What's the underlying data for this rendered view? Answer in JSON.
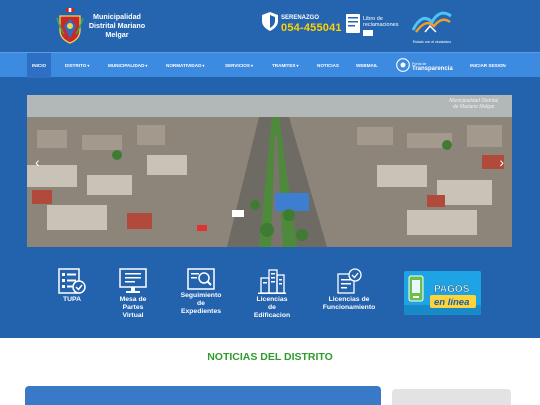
{
  "header": {
    "muni_name": "Municipalidad Distrital Mariano Melgar",
    "serenazgo_label": "SERENAZGO",
    "serenazgo_phone": "054-455041",
    "libro_line1": "Libro de",
    "libro_line2": "reclamaciones",
    "peru_text": "Estado con el ciudadano"
  },
  "nav": {
    "items": [
      {
        "label": "INICIO",
        "caret": ""
      },
      {
        "label": "DISTRITO",
        "caret": "▾"
      },
      {
        "label": "MUNICIPALIDAD",
        "caret": "▾"
      },
      {
        "label": "NORMATIVIDAD",
        "caret": "▾"
      },
      {
        "label": "SERVICIOS",
        "caret": "▾"
      },
      {
        "label": "TRAMITES",
        "caret": "▾"
      },
      {
        "label": "NOTICIAS",
        "caret": ""
      },
      {
        "label": "WEBMAIL",
        "caret": ""
      }
    ],
    "transparencia_small": "Portal de",
    "transparencia_big": "Transparencia",
    "login": "INICIAR SESION"
  },
  "slider": {
    "caption_line1": "Municipalidad Distrital",
    "caption_line2": "de Mariano Melgar",
    "prev": "‹",
    "next": "›"
  },
  "services": [
    {
      "l1": "TUPA",
      "l2": "",
      "l3": "",
      "l4": "",
      "icon": "tupa-icon"
    },
    {
      "l1": "Mesa de",
      "l2": "Partes",
      "l3": "Virtual",
      "l4": "",
      "icon": "monitor-icon"
    },
    {
      "l1": "Seguimiento",
      "l2": "de",
      "l3": "Expedientes",
      "l4": "",
      "icon": "search-document-icon"
    },
    {
      "l1": "Licencias",
      "l2": "de",
      "l3": "Edificacion",
      "l4": "",
      "icon": "buildings-icon"
    },
    {
      "l1": "Licencias de",
      "l2": "Funcionamiento",
      "l3": "",
      "l4": "",
      "icon": "license-icon"
    }
  ],
  "pagos": {
    "line1": "PAGOS",
    "line2": "en línea"
  },
  "news": {
    "title": "NOTICIAS DEL DISTRITO"
  },
  "colors": {
    "header": "#2565b0",
    "nav": "#3c8be0",
    "news_title": "#2e9c2e",
    "phone": "#ffd200"
  }
}
